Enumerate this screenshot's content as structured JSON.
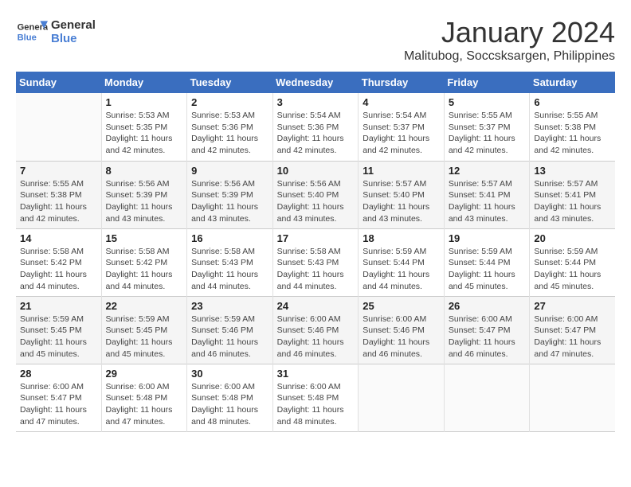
{
  "header": {
    "logo_line1": "General",
    "logo_line2": "Blue",
    "month_year": "January 2024",
    "location": "Malitubog, Soccsksargen, Philippines"
  },
  "days_of_week": [
    "Sunday",
    "Monday",
    "Tuesday",
    "Wednesday",
    "Thursday",
    "Friday",
    "Saturday"
  ],
  "weeks": [
    [
      {
        "num": "",
        "detail": ""
      },
      {
        "num": "1",
        "detail": "Sunrise: 5:53 AM\nSunset: 5:35 PM\nDaylight: 11 hours\nand 42 minutes."
      },
      {
        "num": "2",
        "detail": "Sunrise: 5:53 AM\nSunset: 5:36 PM\nDaylight: 11 hours\nand 42 minutes."
      },
      {
        "num": "3",
        "detail": "Sunrise: 5:54 AM\nSunset: 5:36 PM\nDaylight: 11 hours\nand 42 minutes."
      },
      {
        "num": "4",
        "detail": "Sunrise: 5:54 AM\nSunset: 5:37 PM\nDaylight: 11 hours\nand 42 minutes."
      },
      {
        "num": "5",
        "detail": "Sunrise: 5:55 AM\nSunset: 5:37 PM\nDaylight: 11 hours\nand 42 minutes."
      },
      {
        "num": "6",
        "detail": "Sunrise: 5:55 AM\nSunset: 5:38 PM\nDaylight: 11 hours\nand 42 minutes."
      }
    ],
    [
      {
        "num": "7",
        "detail": "Sunrise: 5:55 AM\nSunset: 5:38 PM\nDaylight: 11 hours\nand 42 minutes."
      },
      {
        "num": "8",
        "detail": "Sunrise: 5:56 AM\nSunset: 5:39 PM\nDaylight: 11 hours\nand 43 minutes."
      },
      {
        "num": "9",
        "detail": "Sunrise: 5:56 AM\nSunset: 5:39 PM\nDaylight: 11 hours\nand 43 minutes."
      },
      {
        "num": "10",
        "detail": "Sunrise: 5:56 AM\nSunset: 5:40 PM\nDaylight: 11 hours\nand 43 minutes."
      },
      {
        "num": "11",
        "detail": "Sunrise: 5:57 AM\nSunset: 5:40 PM\nDaylight: 11 hours\nand 43 minutes."
      },
      {
        "num": "12",
        "detail": "Sunrise: 5:57 AM\nSunset: 5:41 PM\nDaylight: 11 hours\nand 43 minutes."
      },
      {
        "num": "13",
        "detail": "Sunrise: 5:57 AM\nSunset: 5:41 PM\nDaylight: 11 hours\nand 43 minutes."
      }
    ],
    [
      {
        "num": "14",
        "detail": "Sunrise: 5:58 AM\nSunset: 5:42 PM\nDaylight: 11 hours\nand 44 minutes."
      },
      {
        "num": "15",
        "detail": "Sunrise: 5:58 AM\nSunset: 5:42 PM\nDaylight: 11 hours\nand 44 minutes."
      },
      {
        "num": "16",
        "detail": "Sunrise: 5:58 AM\nSunset: 5:43 PM\nDaylight: 11 hours\nand 44 minutes."
      },
      {
        "num": "17",
        "detail": "Sunrise: 5:58 AM\nSunset: 5:43 PM\nDaylight: 11 hours\nand 44 minutes."
      },
      {
        "num": "18",
        "detail": "Sunrise: 5:59 AM\nSunset: 5:44 PM\nDaylight: 11 hours\nand 44 minutes."
      },
      {
        "num": "19",
        "detail": "Sunrise: 5:59 AM\nSunset: 5:44 PM\nDaylight: 11 hours\nand 45 minutes."
      },
      {
        "num": "20",
        "detail": "Sunrise: 5:59 AM\nSunset: 5:44 PM\nDaylight: 11 hours\nand 45 minutes."
      }
    ],
    [
      {
        "num": "21",
        "detail": "Sunrise: 5:59 AM\nSunset: 5:45 PM\nDaylight: 11 hours\nand 45 minutes."
      },
      {
        "num": "22",
        "detail": "Sunrise: 5:59 AM\nSunset: 5:45 PM\nDaylight: 11 hours\nand 45 minutes."
      },
      {
        "num": "23",
        "detail": "Sunrise: 5:59 AM\nSunset: 5:46 PM\nDaylight: 11 hours\nand 46 minutes."
      },
      {
        "num": "24",
        "detail": "Sunrise: 6:00 AM\nSunset: 5:46 PM\nDaylight: 11 hours\nand 46 minutes."
      },
      {
        "num": "25",
        "detail": "Sunrise: 6:00 AM\nSunset: 5:46 PM\nDaylight: 11 hours\nand 46 minutes."
      },
      {
        "num": "26",
        "detail": "Sunrise: 6:00 AM\nSunset: 5:47 PM\nDaylight: 11 hours\nand 46 minutes."
      },
      {
        "num": "27",
        "detail": "Sunrise: 6:00 AM\nSunset: 5:47 PM\nDaylight: 11 hours\nand 47 minutes."
      }
    ],
    [
      {
        "num": "28",
        "detail": "Sunrise: 6:00 AM\nSunset: 5:47 PM\nDaylight: 11 hours\nand 47 minutes."
      },
      {
        "num": "29",
        "detail": "Sunrise: 6:00 AM\nSunset: 5:48 PM\nDaylight: 11 hours\nand 47 minutes."
      },
      {
        "num": "30",
        "detail": "Sunrise: 6:00 AM\nSunset: 5:48 PM\nDaylight: 11 hours\nand 48 minutes."
      },
      {
        "num": "31",
        "detail": "Sunrise: 6:00 AM\nSunset: 5:48 PM\nDaylight: 11 hours\nand 48 minutes."
      },
      {
        "num": "",
        "detail": ""
      },
      {
        "num": "",
        "detail": ""
      },
      {
        "num": "",
        "detail": ""
      }
    ]
  ]
}
